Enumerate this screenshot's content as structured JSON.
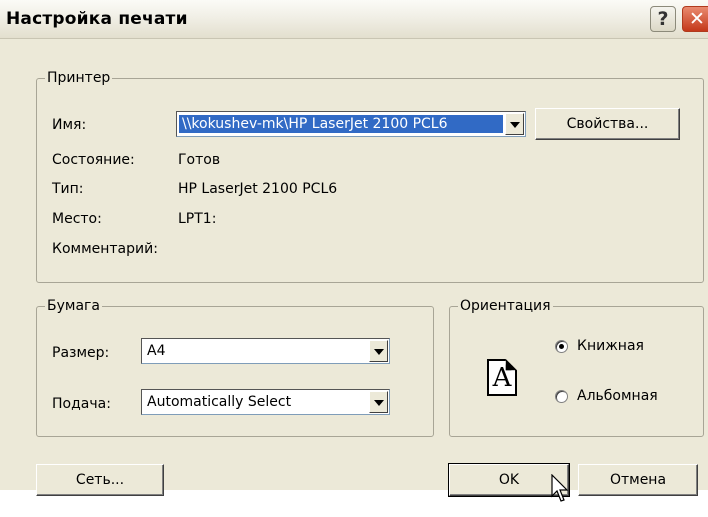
{
  "window": {
    "title": "Настройка печати",
    "help_glyph": "?",
    "close_glyph": "✕"
  },
  "printer": {
    "legend": "Принтер",
    "name_label": "Имя:",
    "name_value": "\\\\kokushev-mk\\HP LaserJet 2100 PCL6",
    "properties_button": "Свойства...",
    "status_label": "Состояние:",
    "status_value": "Готов",
    "type_label": "Тип:",
    "type_value": "HP LaserJet 2100 PCL6",
    "location_label": "Место:",
    "location_value": "LPT1:",
    "comment_label": "Комментарий:",
    "comment_value": ""
  },
  "paper": {
    "legend": "Бумага",
    "size_label": "Размер:",
    "size_value": "A4",
    "source_label": "Подача:",
    "source_value": "Automatically Select"
  },
  "orientation": {
    "legend": "Ориентация",
    "icon_letter": "A",
    "portrait_label": "Книжная",
    "landscape_label": "Альбомная",
    "selected": "portrait"
  },
  "footer": {
    "network_button": "Сеть...",
    "ok_button": "OK",
    "cancel_button": "Отмена"
  },
  "icons": {
    "help": "help-icon",
    "close": "close-icon",
    "dropdown": "chevron-down-icon",
    "page": "page-portrait-icon",
    "cursor": "mouse-pointer-icon"
  }
}
